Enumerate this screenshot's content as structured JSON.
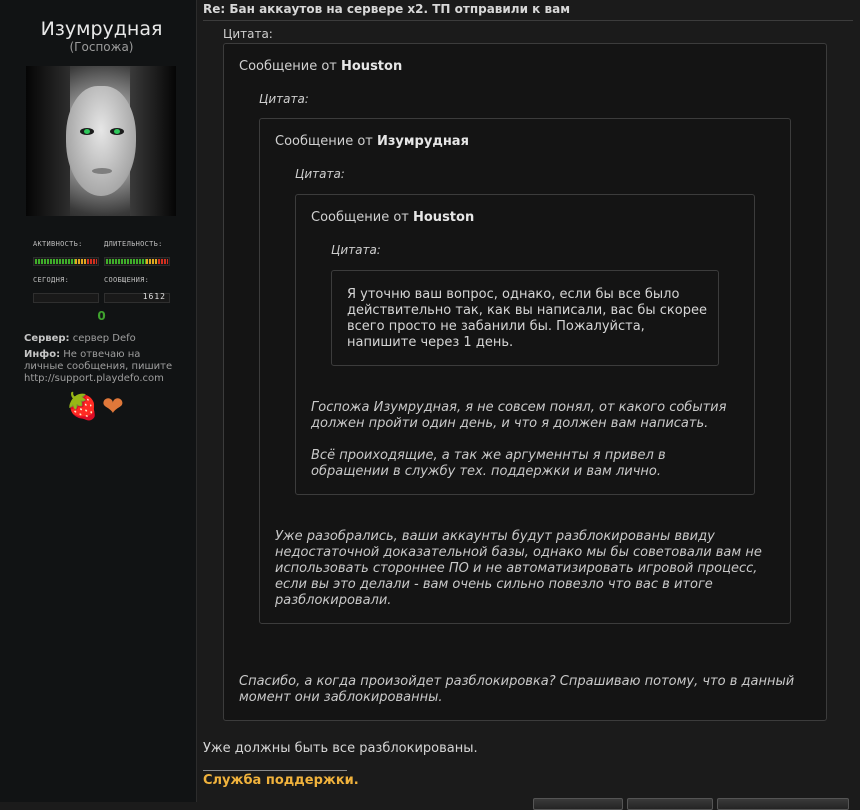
{
  "user": {
    "name": "Изумрудная",
    "title": "(Госпожа)",
    "stats": {
      "activity_label": "Активность:",
      "duration_label": "Длительность:",
      "today_label": "Сегодня:",
      "messages_label": "Сообщения:",
      "messages_value": "1612",
      "today_value": "0"
    },
    "server_label": "Сервер:",
    "server_value": "сервер Defo",
    "info_label": "Инфо:",
    "info_value": "Не отвечаю на личные сообщения, пишите http://support.playdefo.com",
    "awards": [
      "strawberry-icon",
      "winged-heart-icon"
    ]
  },
  "post": {
    "title": "Re: Бан аккаутов на сервере x2. ТП отправили к вам",
    "quote1": {
      "label": "Цитата:",
      "header_prefix": "Сообщение от",
      "author": "Houston",
      "reply": "Спасибо, а когда произойдет разблокировка? Спрашиваю потому, что в данный момент они заблокированны."
    },
    "quote2": {
      "label": "Цитата:",
      "header_prefix": "Сообщение от",
      "author": "Изумрудная",
      "reply": "Уже разобрались, ваши аккаунты будут разблокированы ввиду недостаточной доказательной базы, однако мы бы советовали вам не использовать стороннее ПО и не автоматизировать игровой процесс, если вы это делали - вам очень сильно повезло что вас в итоге разблокировали."
    },
    "quote3": {
      "label": "Цитата:",
      "header_prefix": "Сообщение от",
      "author": "Houston",
      "reply_p1": "Госпожа Изумрудная, я не совсем понял, от какого события должен пройти один день, и что я должен вам написать.",
      "reply_p2": "Всё проиходящие, а так же аргуменнты я привел в обращении в службу тех. поддержки и вам лично."
    },
    "quote4": {
      "label": "Цитата:",
      "text": "Я уточню ваш вопрос, однако, если бы все было действительно так, как вы написали, вас бы скорее всего просто не забанили бы. Пожалуйста, напишите через 1 день."
    },
    "body": "Уже должны быть все разблокированы.",
    "signature": "Служба поддержки."
  }
}
